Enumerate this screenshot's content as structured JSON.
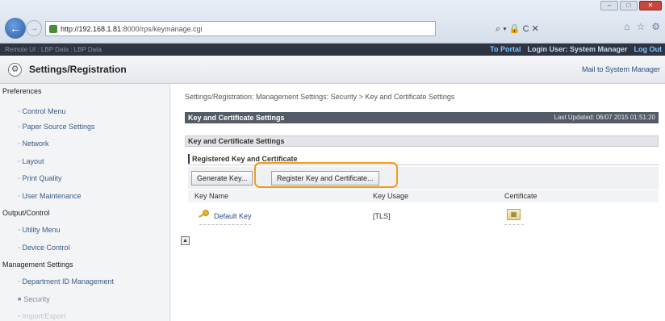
{
  "browser": {
    "url_host": "http://192.168.1.81",
    "url_path": ":8000/rps/keymanage.cgi",
    "search_icons": "⌕ ▾ 🔒 C ✕",
    "window_controls": [
      "–",
      "□",
      "✕"
    ],
    "toolbar_icons": [
      "⌂",
      "☆",
      "⚙"
    ]
  },
  "appbar": {
    "device_label": "Remote UI  :  LBP Data : LBP Data",
    "portal": "To Portal",
    "login": "Login User: System Manager",
    "logout": "Log Out"
  },
  "header": {
    "title": "Settings/Registration",
    "mailto": "Mail to System Manager"
  },
  "sidebar": {
    "sections": [
      {
        "label": "Preferences",
        "items": [
          "Control Menu",
          "Paper Source Settings",
          "Network",
          "Layout",
          "Print Quality",
          "User Maintenance"
        ]
      },
      {
        "label": "Output/Control",
        "items": [
          "Utility Menu",
          "Device Control"
        ]
      },
      {
        "label": "Management Settings",
        "items": [
          "Department ID Management",
          "Security",
          "Import/Export"
        ]
      }
    ]
  },
  "main": {
    "breadcrumb": "Settings/Registration: Management Settings: Security > Key and Certificate Settings",
    "bar_title": "Key and Certificate Settings",
    "last_updated": "Last Updated: 06/07 2015 01:51:20",
    "section_title": "Key and Certificate Settings",
    "subhead": "Registered Key and Certificate",
    "buttons": {
      "generate": "Generate Key...",
      "register": "Register Key and Certificate..."
    },
    "table": {
      "headers": [
        "Key Name",
        "Key Usage",
        "Certificate"
      ],
      "rows": [
        {
          "key_name": "Default Key",
          "usage": "[TLS]"
        }
      ]
    }
  }
}
